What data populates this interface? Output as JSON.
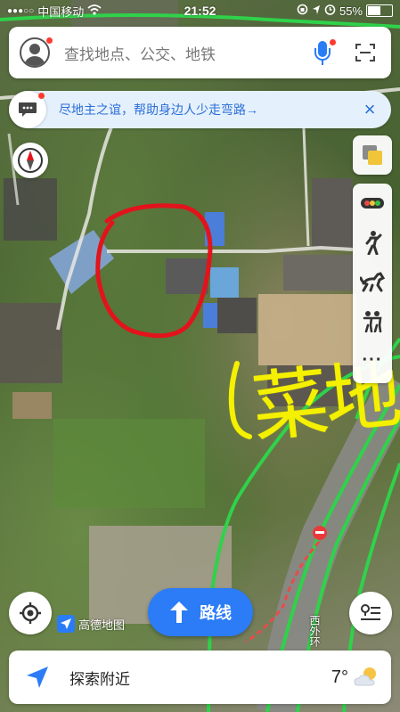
{
  "status_bar": {
    "signal": "●●●○○",
    "carrier": "中国移动",
    "time": "21:52",
    "battery": "55%",
    "battery_level": 0.55
  },
  "search": {
    "placeholder": "查找地点、公交、地铁",
    "avatar_icon": "user-avatar-icon",
    "mic_icon": "microphone-icon",
    "scan_icon": "scan-icon"
  },
  "notice": {
    "text": "尽地主之谊，帮助身边人少走弯路→",
    "icon": "message-icon",
    "close": "×"
  },
  "map": {
    "road_labels": [
      "西外环"
    ],
    "annotation": "菜地",
    "annotation_color": "#f4f000",
    "circle_color": "#e3131b"
  },
  "tools": {
    "layers_icon": "layers-icon",
    "items": [
      "traffic-icon",
      "walk-icon",
      "horse-icon",
      "people-icon",
      "more-icon"
    ],
    "more_label": "···"
  },
  "bottom": {
    "logo_text": "高德地图",
    "route_label": "路线",
    "explore_label": "探索附近",
    "temperature": "7°",
    "weather_icon": "partly-cloudy-icon"
  },
  "colors": {
    "accent": "#2b7cf6",
    "notice_bg": "#e5f0fd",
    "notice_text": "#2b6fd6",
    "road_green": "#2fd24a"
  }
}
